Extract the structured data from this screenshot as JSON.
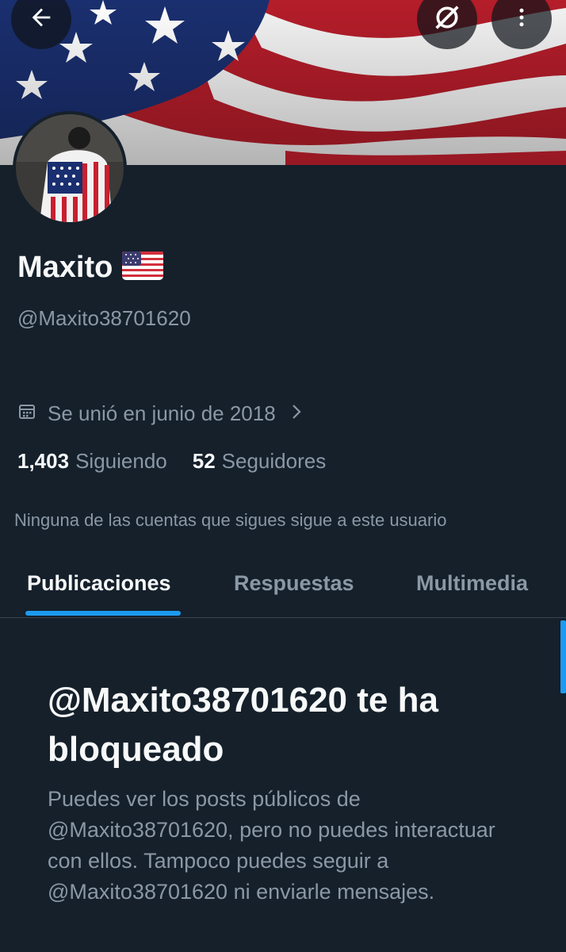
{
  "header": {
    "back_icon": "arrow-left-icon",
    "sync_icon": "circle-slash-icon",
    "more_icon": "more-vertical-icon"
  },
  "banner": {
    "colors": {
      "blue": "#1a2f6f",
      "red": "#c8202f",
      "white": "#ffffff"
    }
  },
  "profile": {
    "name": "Maxito",
    "name_emoji": "us-flag",
    "handle": "@Maxito38701620",
    "joined": "Se unió en junio de 2018",
    "following_count": "1,403",
    "following_label": "Siguiendo",
    "followers_count": "52",
    "followers_label": "Seguidores",
    "mutual_notice": "Ninguna de las cuentas que sigues sigue a este usuario"
  },
  "tabs": [
    {
      "label": "Publicaciones",
      "active": true
    },
    {
      "label": "Respuestas",
      "active": false
    },
    {
      "label": "Multimedia",
      "active": false
    }
  ],
  "blocked": {
    "title": "@Maxito38701620 te ha bloqueado",
    "body": "Puedes ver los posts públicos de @Maxito38701620, pero no puedes interactuar con ellos. Tampoco puedes seguir a @Maxito38701620 ni enviarle mensajes."
  },
  "colors": {
    "background": "#15202b",
    "accent": "#1d9bf0",
    "text_primary": "#f7f9f9",
    "text_secondary": "#8b98a5"
  }
}
